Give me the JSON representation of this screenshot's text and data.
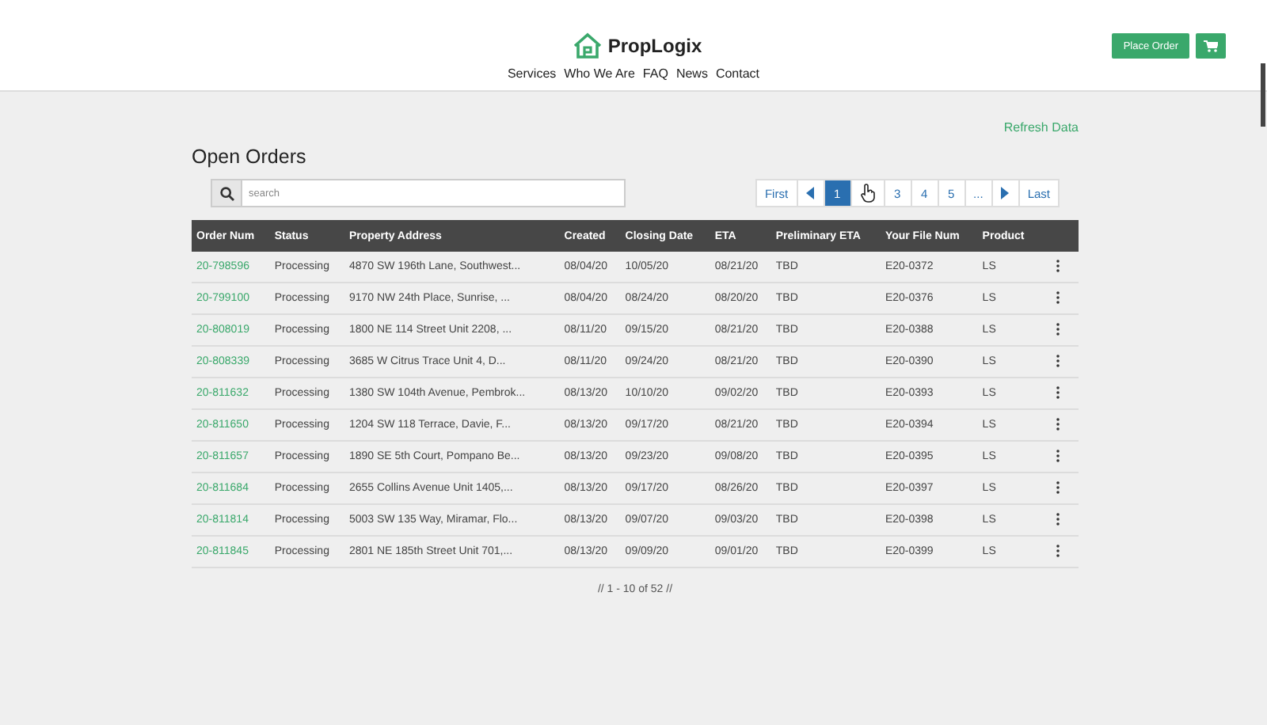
{
  "header": {
    "brand": "PropLogix",
    "nav": [
      "Services",
      "Who We Are",
      "FAQ",
      "News",
      "Contact"
    ],
    "place_order": "Place Order"
  },
  "refresh": "Refresh Data",
  "title": "Open Orders",
  "search": {
    "placeholder": "search"
  },
  "pager": [
    {
      "kind": "text",
      "label": "First",
      "selected": false
    },
    {
      "kind": "prev",
      "selected": false
    },
    {
      "kind": "text",
      "label": "1",
      "selected": true
    },
    {
      "kind": "cursor",
      "selected": false
    },
    {
      "kind": "text",
      "label": "3",
      "selected": false
    },
    {
      "kind": "text",
      "label": "4",
      "selected": false
    },
    {
      "kind": "text",
      "label": "5",
      "selected": false
    },
    {
      "kind": "text",
      "label": "...",
      "selected": false
    },
    {
      "kind": "next",
      "selected": false
    },
    {
      "kind": "text",
      "label": "Last",
      "selected": false
    }
  ],
  "table": {
    "columns": [
      "Order Num",
      "Status",
      "Property Address",
      "Created",
      "Closing Date",
      "ETA",
      "Preliminary ETA",
      "Your File Num",
      "Product"
    ],
    "rows": [
      [
        "20-798596",
        "Processing",
        "4870 SW 196th Lane, Southwest...",
        "08/04/20",
        "10/05/20",
        "08/21/20",
        "TBD",
        "E20-0372",
        "LS"
      ],
      [
        "20-799100",
        "Processing",
        "9170 NW 24th Place, Sunrise, ...",
        "08/04/20",
        "08/24/20",
        "08/20/20",
        "TBD",
        "E20-0376",
        "LS"
      ],
      [
        "20-808019",
        "Processing",
        "1800 NE 114 Street Unit 2208, ...",
        "08/11/20",
        "09/15/20",
        "08/21/20",
        "TBD",
        "E20-0388",
        "LS"
      ],
      [
        "20-808339",
        "Processing",
        "3685 W Citrus Trace Unit 4, D...",
        "08/11/20",
        "09/24/20",
        "08/21/20",
        "TBD",
        "E20-0390",
        "LS"
      ],
      [
        "20-811632",
        "Processing",
        "1380 SW 104th Avenue, Pembrok...",
        "08/13/20",
        "10/10/20",
        "09/02/20",
        "TBD",
        "E20-0393",
        "LS"
      ],
      [
        "20-811650",
        "Processing",
        "1204 SW 118 Terrace, Davie, F...",
        "08/13/20",
        "09/17/20",
        "08/21/20",
        "TBD",
        "E20-0394",
        "LS"
      ],
      [
        "20-811657",
        "Processing",
        "1890 SE 5th Court, Pompano Be...",
        "08/13/20",
        "09/23/20",
        "09/08/20",
        "TBD",
        "E20-0395",
        "LS"
      ],
      [
        "20-811684",
        "Processing",
        "2655 Collins Avenue Unit 1405,...",
        "08/13/20",
        "09/17/20",
        "08/26/20",
        "TBD",
        "E20-0397",
        "LS"
      ],
      [
        "20-811814",
        "Processing",
        "5003 SW 135 Way, Miramar, Flo...",
        "08/13/20",
        "09/07/20",
        "09/03/20",
        "TBD",
        "E20-0398",
        "LS"
      ],
      [
        "20-811845",
        "Processing",
        "2801 NE 185th Street Unit 701,...",
        "08/13/20",
        "09/09/20",
        "09/01/20",
        "TBD",
        "E20-0399",
        "LS"
      ]
    ]
  },
  "footer": "// 1 - 10 of 52 //"
}
